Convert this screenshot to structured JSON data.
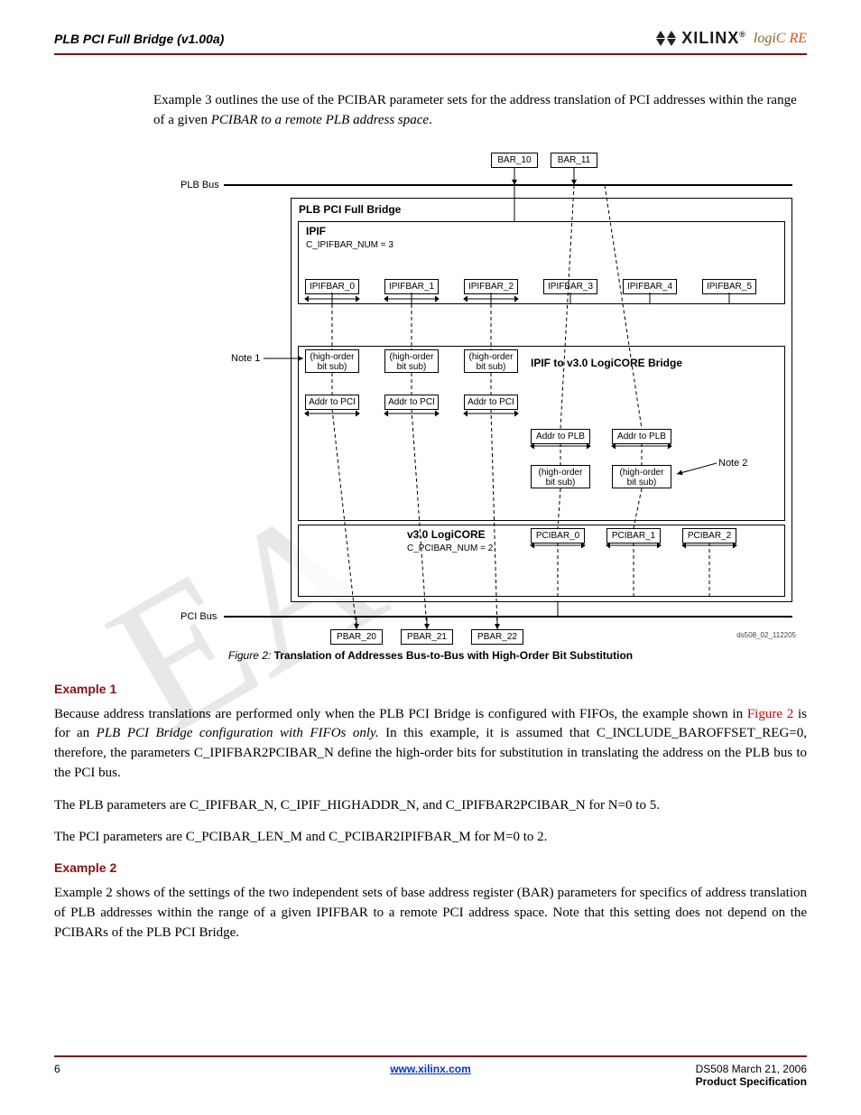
{
  "header": {
    "title": "PLB PCI Full Bridge (v1.00a)",
    "brand": "XILINX",
    "brand_reg": "®",
    "logicore_logi": "logi",
    "logicore_core": "C  RE"
  },
  "intro": {
    "text1": "Example 3 outlines the use of the PCIBAR parameter sets for the address translation of PCI addresses within the range of a given ",
    "italic": "PCIBAR to a remote PLB address space",
    "text2": "."
  },
  "figure": {
    "plb_bus": "PLB Bus",
    "pci_bus": "PCI Bus",
    "bridge_title": "PLB PCI Full Bridge",
    "ipif_title": "IPIF",
    "ipif_param": "C_IPIFBAR_NUM = 3",
    "ipif2_title": "IPIF to v3.0 LogiCORE Bridge",
    "v3_title": "v3.0 LogiCORE",
    "v3_param": "C_PCIBAR_NUM = 2",
    "note1": "Note 1",
    "note2": "Note 2",
    "bar10": "BAR_10",
    "bar11": "BAR_11",
    "ipifbar": [
      "IPIFBAR_0",
      "IPIFBAR_1",
      "IPIFBAR_2",
      "IPIFBAR_3",
      "IPIFBAR_4",
      "IPIFBAR_5"
    ],
    "highorder": "(high-order bit sub)",
    "addr_pci": "Addr to PCI",
    "addr_plb": "Addr to PLB",
    "pcibar": [
      "PCIBAR_0",
      "PCIBAR_1",
      "PCIBAR_2"
    ],
    "pbar": [
      "PBAR_20",
      "PBAR_21",
      "PBAR_22"
    ],
    "ref": "ds508_02_112205"
  },
  "figcaption": {
    "ref": "Figure 2:",
    "title": "Translation of Addresses Bus-to-Bus with High-Order Bit Substitution"
  },
  "example1": {
    "heading": "Example 1",
    "p1a": "Because address translations are performed only when the PLB PCI Bridge is configured with FIFOs, the example shown in ",
    "p1link": "Figure 2",
    "p1b": " is for an ",
    "p1ital": "PLB PCI Bridge configuration with FIFOs only.",
    "p1c": " In this example, it is assumed that C_INCLUDE_BAROFFSET_REG=0, therefore, the parameters C_IPIFBAR2PCIBAR_N define the high-order bits for substitution in translating the address on the PLB bus to the PCI bus.",
    "p2": "The PLB parameters are C_IPIFBAR_N, C_IPIF_HIGHADDR_N, and C_IPIFBAR2PCIBAR_N for N=0 to 5.",
    "p3": "The PCI parameters are C_PCIBAR_LEN_M and C_PCIBAR2IPIFBAR_M for M=0 to 2."
  },
  "example2": {
    "heading": "Example 2",
    "p1": "Example 2 shows of the settings of the two independent sets of base address register (BAR) parameters for specifics of address translation of PLB addresses within the range of a given IPIFBAR to a remote PCI address space. Note that this setting does not depend on the PCIBARs of the PLB PCI Bridge."
  },
  "footer": {
    "page": "6",
    "link": "www.xilinx.com",
    "docid": "DS508 March 21, 2006",
    "spec": "Product Specification"
  }
}
